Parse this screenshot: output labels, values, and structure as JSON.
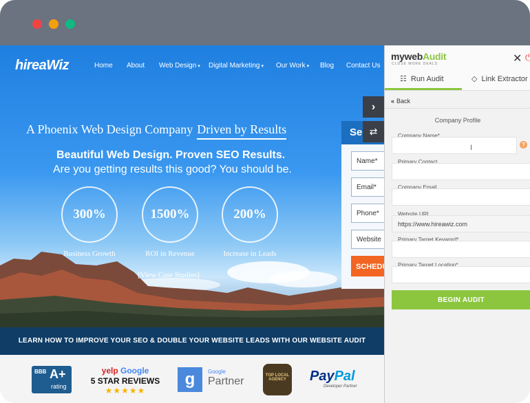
{
  "site": {
    "logo": "hireaWiz",
    "nav": [
      "Home",
      "About",
      "Web Design",
      "Digital Marketing",
      "Our Work",
      "Blog",
      "Contact Us"
    ],
    "headline_part1": "A Phoenix Web Design Company",
    "headline_part2": "Driven by Results",
    "subhead": "Beautiful Web Design. Proven SEO Results.",
    "subhead2": "Are you getting results this good? You should be.",
    "stats": [
      {
        "value": "300%",
        "label": "Business Growth"
      },
      {
        "value": "1500%",
        "label": "ROI in Revenue"
      },
      {
        "value": "200%",
        "label": "Increase in Leads"
      }
    ],
    "case_link": "[View Case Studies]",
    "form": {
      "title": "Se",
      "fields": [
        "Name*",
        "Email*",
        "Phone*",
        "Website"
      ],
      "button": "SCHEDU"
    },
    "banner": "LEARN HOW TO IMPROVE YOUR SEO & DOUBLE YOUR WEBSITE LEADS WITH OUR WEBSITE AUDIT",
    "badges": {
      "bbb_title": "BBB",
      "bbb_grade": "A+",
      "bbb_rating": "rating",
      "yelp": "yelp",
      "google": "Google",
      "reviews": "5 STAR REVIEWS",
      "stars": "★★★★★",
      "gp_small": "Google",
      "gp_big": "Partner",
      "agency": "TOP LOCAL AGENCY",
      "paypal_pay": "Pay",
      "paypal_pal": "Pal",
      "paypal_sub": "Developer Partner"
    }
  },
  "panel": {
    "brand_prefix": "myweb",
    "brand_suffix": "Audit",
    "brand_sub": "CLOSE MORE DEALS",
    "tabs": [
      "Run Audit",
      "Link Extractor"
    ],
    "back": "Back",
    "section_title": "Company Profile",
    "fields": [
      {
        "label": "Company Name*",
        "value": ""
      },
      {
        "label": "Primary Contact",
        "value": ""
      },
      {
        "label": "Company Email",
        "value": ""
      },
      {
        "label": "Website URL",
        "value": "https://www.hireawiz.com"
      },
      {
        "label": "Primary Target Keyword*",
        "value": ""
      },
      {
        "label": "Primary Target Location*",
        "value": ""
      }
    ],
    "begin_button": "BEGIN AUDIT"
  },
  "colors": {
    "accent_green": "#8cc63f",
    "banner_navy": "#0f3d66",
    "schedule_orange": "#f26522"
  }
}
